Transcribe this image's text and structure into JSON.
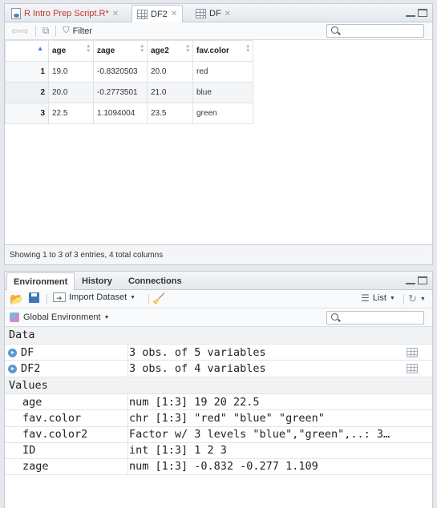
{
  "top_tabs": [
    {
      "label": "R Intro Prep Script.R*",
      "modified_color": "#c0392b"
    },
    {
      "label": "DF2"
    },
    {
      "label": "DF"
    }
  ],
  "viewer": {
    "filter_label": "Filter",
    "search_placeholder": "",
    "columns": [
      "age",
      "zage",
      "age2",
      "fav.color"
    ],
    "rows": [
      {
        "n": "1",
        "cells": [
          "19.0",
          "-0.8320503",
          "20.0",
          "red"
        ]
      },
      {
        "n": "2",
        "cells": [
          "20.0",
          "-0.2773501",
          "21.0",
          "blue"
        ]
      },
      {
        "n": "3",
        "cells": [
          "22.5",
          "1.1094004",
          "23.5",
          "green"
        ]
      }
    ],
    "status": "Showing 1 to 3 of 3 entries, 4 total columns"
  },
  "bottom_tabs": [
    "Environment",
    "History",
    "Connections"
  ],
  "env_toolbar": {
    "import_label": "Import Dataset",
    "list_label": "List",
    "scope_label": "Global Environment",
    "search_placeholder": ""
  },
  "env": {
    "data_header": "Data",
    "data": [
      {
        "name": "DF",
        "value": "3 obs. of 5 variables"
      },
      {
        "name": "DF2",
        "value": "3 obs. of 4 variables"
      }
    ],
    "values_header": "Values",
    "values": [
      {
        "name": "age",
        "value": "num [1:3] 19 20 22.5"
      },
      {
        "name": "fav.color",
        "value": "chr [1:3] \"red\" \"blue\" \"green\""
      },
      {
        "name": "fav.color2",
        "value": "Factor w/ 3 levels \"blue\",\"green\",..: 3…"
      },
      {
        "name": "ID",
        "value": "int [1:3] 1 2 3"
      },
      {
        "name": "zage",
        "value": "num [1:3] -0.832 -0.277 1.109"
      }
    ]
  },
  "colors": {
    "accent_blue": "#4a87c8",
    "sort_active": "#3b7ac9"
  }
}
